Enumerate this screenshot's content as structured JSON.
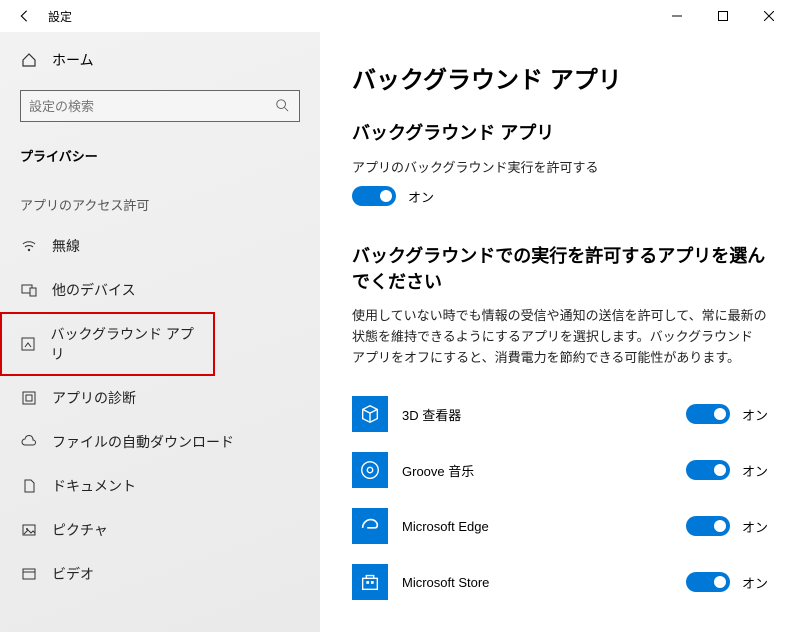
{
  "window": {
    "title": "設定"
  },
  "sidebar": {
    "home_label": "ホーム",
    "search_placeholder": "設定の検索",
    "group1_header": "プライバシー",
    "group2_header": "アプリのアクセス許可",
    "items": [
      {
        "label": "無線"
      },
      {
        "label": "他のデバイス"
      },
      {
        "label": "バックグラウンド アプリ"
      },
      {
        "label": "アプリの診断"
      },
      {
        "label": "ファイルの自動ダウンロード"
      },
      {
        "label": "ドキュメント"
      },
      {
        "label": "ピクチャ"
      },
      {
        "label": "ビデオ"
      }
    ]
  },
  "main": {
    "page_title": "バックグラウンド アプリ",
    "section1_title": "バックグラウンド アプリ",
    "permission_label": "アプリのバックグラウンド実行を許可する",
    "master_toggle_state": "オン",
    "section2_title": "バックグラウンドでの実行を許可するアプリを選んでください",
    "description": "使用していない時でも情報の受信や通知の送信を許可して、常に最新の状態を維持できるようにするアプリを選択します。バックグラウンド アプリをオフにすると、消費電力を節約できる可能性があります。",
    "apps": [
      {
        "name": "3D 查看器",
        "state": "オン",
        "icon": "cube"
      },
      {
        "name": "Groove 音乐",
        "state": "オン",
        "icon": "groove"
      },
      {
        "name": "Microsoft Edge",
        "state": "オン",
        "icon": "edge"
      },
      {
        "name": "Microsoft Store",
        "state": "オン",
        "icon": "store"
      }
    ]
  },
  "colors": {
    "accent": "#0078d7",
    "highlight": "#d40000"
  }
}
